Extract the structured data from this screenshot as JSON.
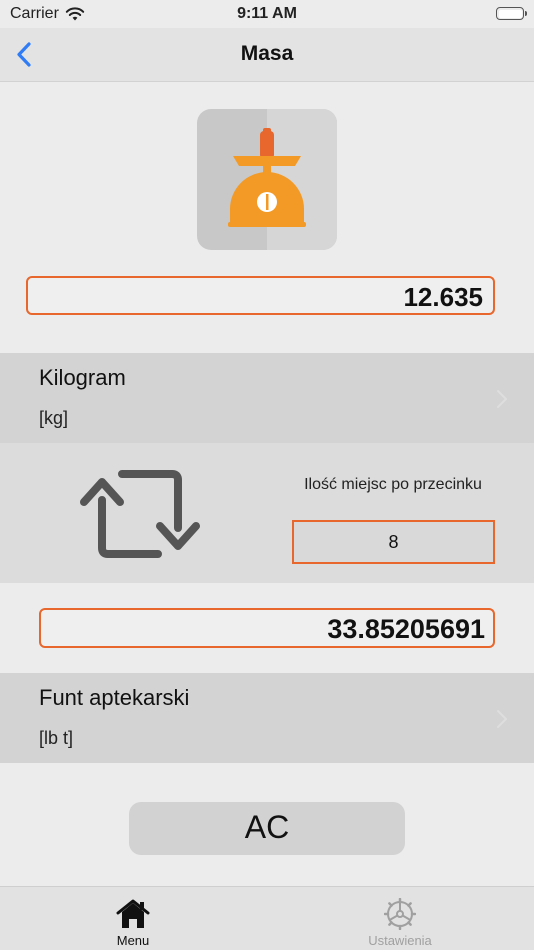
{
  "status_bar": {
    "carrier": "Carrier",
    "time": "9:11 AM"
  },
  "nav": {
    "title": "Masa",
    "back_icon": "chevron-left-icon"
  },
  "converter": {
    "icon": "kitchen-scale-icon",
    "input_value": "12.635",
    "from_unit": {
      "name": "Kilogram",
      "symbol": "[kg]"
    },
    "swap_icon": "swap-arrows-icon",
    "decimals_label": "Ilość miejsc po przecinku",
    "decimals_value": "8",
    "result_value": "33.85205691",
    "to_unit": {
      "name": "Funt aptekarski",
      "symbol": "[lb t]"
    },
    "clear_label": "AC"
  },
  "tab_bar": {
    "tabs": [
      {
        "label": "Menu",
        "icon": "home-icon",
        "active": true
      },
      {
        "label": "Ustawienia",
        "icon": "gear-icon",
        "active": false
      }
    ]
  },
  "colors": {
    "accent_orange": "#e8672c",
    "ios_blue": "#2f7cf6",
    "background": "#ececec",
    "row_gray": "#d3d3d3"
  }
}
